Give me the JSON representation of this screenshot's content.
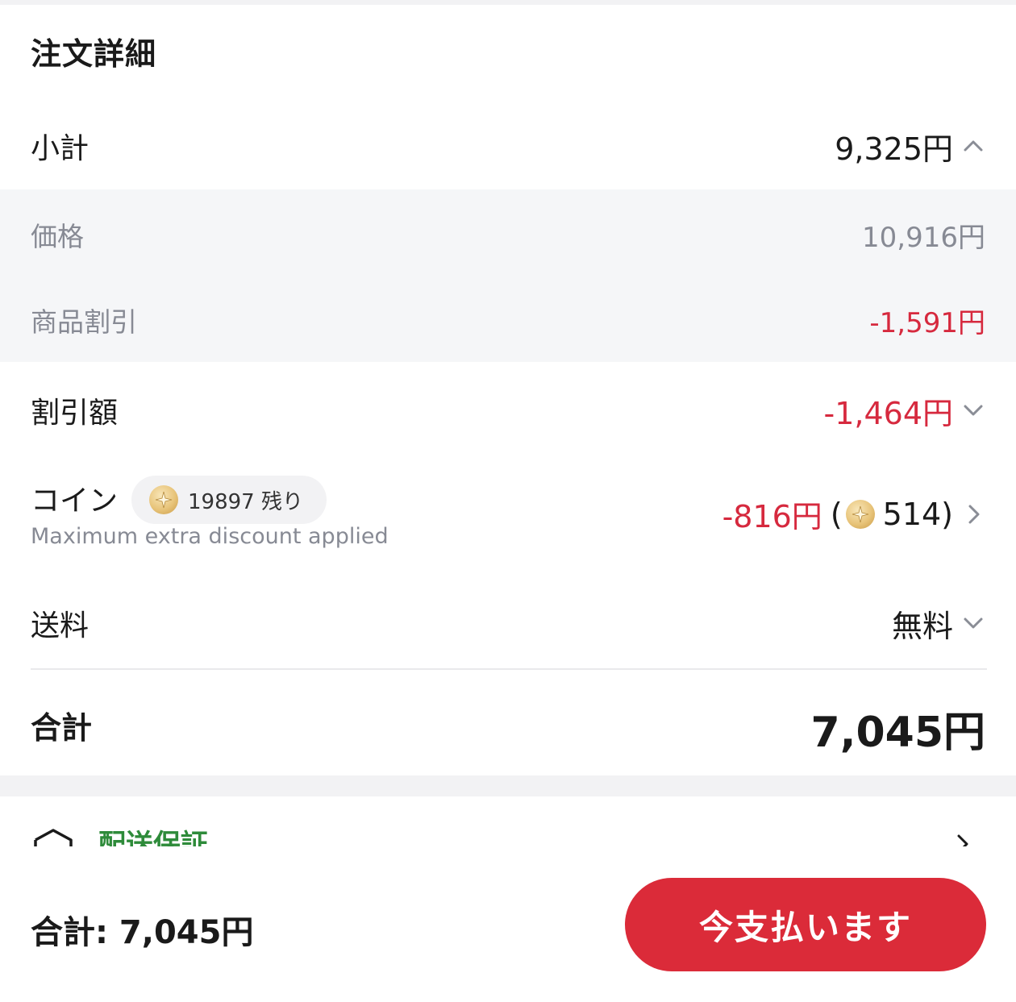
{
  "order_details": {
    "title": "注文詳細",
    "subtotal": {
      "label": "小計",
      "value": "9,325円"
    },
    "price": {
      "label": "価格",
      "value": "10,916円"
    },
    "product_discount": {
      "label": "商品割引",
      "value": "-1,591円"
    },
    "discount": {
      "label": "割引額",
      "value": "-1,464円"
    },
    "coin": {
      "label": "コイン",
      "balance_badge": "19897 残り",
      "note": "Maximum extra discount applied",
      "amount": "-816円",
      "coins_used_open": "(",
      "coins_used": "514)"
    },
    "shipping": {
      "label": "送料",
      "value": "無料"
    },
    "total": {
      "label": "合計",
      "value": "7,045円"
    }
  },
  "shipping_guarantee": {
    "label": "配送保証"
  },
  "footer": {
    "total": "合計: 7,045円",
    "pay_button": "今支払います"
  },
  "colors": {
    "discount_red": "#d6293e",
    "button_red": "#db2b39",
    "guarantee_green": "#2e8b3a",
    "muted_gray": "#878a94"
  },
  "icons": [
    "chevron-up-icon",
    "chevron-down-icon",
    "chevron-right-icon",
    "coin-icon",
    "shield-icon"
  ]
}
